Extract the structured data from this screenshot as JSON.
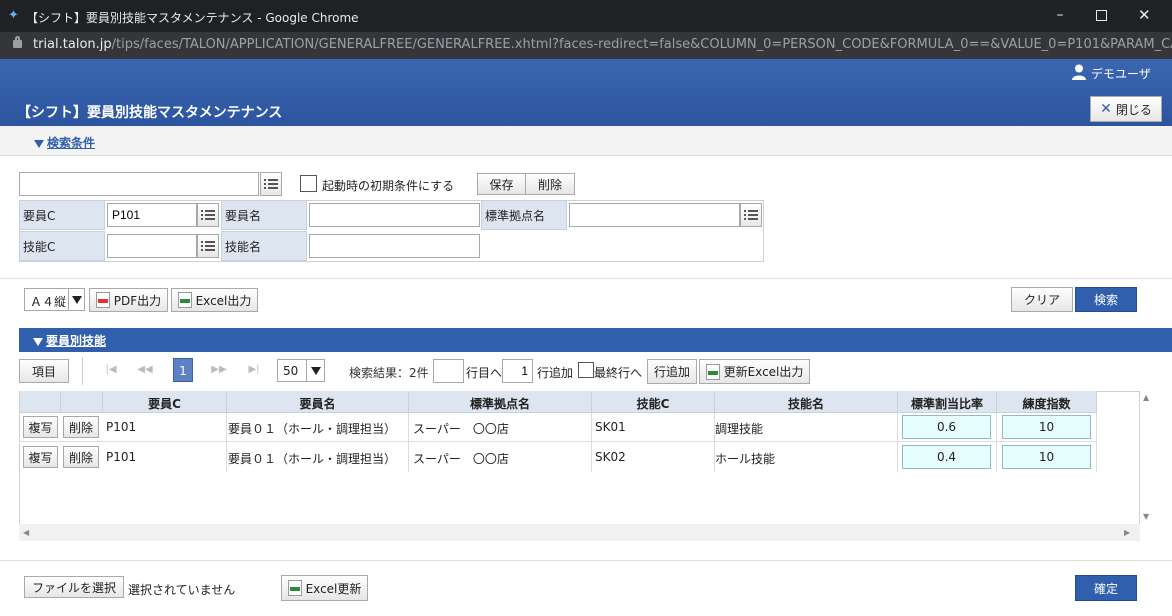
{
  "window": {
    "title": "【シフト】要員別技能マスタメンテナンス - Google Chrome",
    "url_host": "trial.talon.jp",
    "url_path": "/tips/faces/TALON/APPLICATION/GENERALFREE/GENERALFREE.xhtml?faces-redirect=false&COLUMN_0=PERSON_CODE&FORMULA_0==&VALUE_0=P101&PARAM_CA..."
  },
  "header": {
    "user": "デモユーザ",
    "title": "【シフト】要員別技能マスタメンテナンス",
    "close_label": "閉じる"
  },
  "search": {
    "section_label": "検索条件",
    "preset_value": "",
    "startup_checkbox_label": "起動時の初期条件にする",
    "save_label": "保存",
    "delete_label": "削除",
    "labels": {
      "staff_code": "要員C",
      "staff_name": "要員名",
      "base_name": "標準拠点名",
      "skill_code": "技能C",
      "skill_name": "技能名"
    },
    "values": {
      "staff_code": "P101",
      "staff_name": "",
      "base_name": "",
      "skill_code": "",
      "skill_name": ""
    }
  },
  "toolbar": {
    "paper": "Ａ４縦",
    "pdf_label": "PDF出力",
    "excel_label": "Excel出力",
    "clear_label": "クリア",
    "search_label": "検索"
  },
  "results": {
    "section_label": "要員別技能",
    "items_label": "項目",
    "page": "1",
    "page_size": "50",
    "result_text": "検索結果：2件",
    "goto_value": "",
    "goto_label": "行目へ",
    "add_count": "1",
    "add_label": "行追加",
    "last_row_label": "最終行へ",
    "add_row_button": "行追加",
    "update_excel_label": "更新Excel出力",
    "columns": [
      "要員C",
      "要員名",
      "標準拠点名",
      "技能C",
      "技能名",
      "標準割当比率",
      "練度指数"
    ],
    "copy_label": "複写",
    "row_delete_label": "削除",
    "rows": [
      {
        "staff_code": "P101",
        "staff_name": "要員０１（ホール・調理担当）",
        "base_name": "スーパー　〇〇店",
        "skill_code": "SK01",
        "skill_name": "調理技能",
        "ratio": "0.6",
        "level": "10"
      },
      {
        "staff_code": "P101",
        "staff_name": "要員０１（ホール・調理担当）",
        "base_name": "スーパー　〇〇店",
        "skill_code": "SK02",
        "skill_name": "ホール技能",
        "ratio": "0.4",
        "level": "10"
      }
    ]
  },
  "footer": {
    "file_button": "ファイルを選択",
    "file_status": "選択されていません",
    "excel_update_label": "Excel更新",
    "confirm_label": "確定"
  }
}
